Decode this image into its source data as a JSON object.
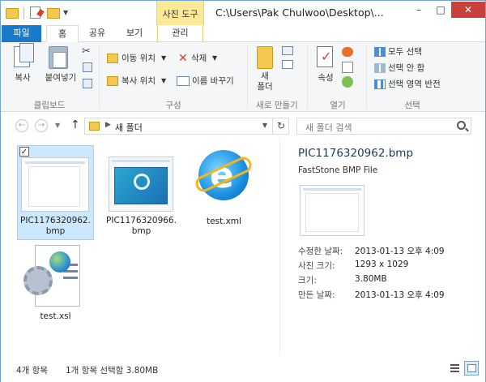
{
  "titlebar": {
    "context_tab": "사진 도구",
    "path": "C:\\Users\\Pak Chulwoo\\Desktop\\..."
  },
  "tabs": {
    "file": "파일",
    "home": "홈",
    "share": "공유",
    "view": "보기",
    "manage": "관리"
  },
  "ribbon": {
    "clipboard": {
      "label": "클립보드",
      "copy": "복사",
      "paste": "붙여넣기"
    },
    "organize": {
      "label": "구성",
      "move_to": "이동 위치",
      "copy_to": "복사 위치",
      "delete": "삭제",
      "rename": "이름 바꾸기"
    },
    "new": {
      "label": "새로 만들기",
      "new_folder": "새\n폴더"
    },
    "open": {
      "label": "열기",
      "properties": "속성"
    },
    "select": {
      "label": "선택",
      "select_all": "모두 선택",
      "select_none": "선택 안 함",
      "invert": "선택 영역 반전"
    }
  },
  "navigation": {
    "address": "새 폴더",
    "search_placeholder": "새 폴더 검색"
  },
  "files": [
    {
      "name": "PIC1176320962.\nbmp",
      "selected": true
    },
    {
      "name": "PIC1176320966.\nbmp",
      "selected": false
    },
    {
      "name": "test.xml",
      "selected": false
    },
    {
      "name": "test.xsl",
      "selected": false
    }
  ],
  "preview": {
    "title": "PIC1176320962.bmp",
    "type": "FastStone BMP File",
    "props": [
      {
        "label": "수정한 날짜:",
        "value": "2013-01-13 오후 4:09"
      },
      {
        "label": "사진 크기:",
        "value": "1293 x 1029"
      },
      {
        "label": "크기:",
        "value": "3.80MB"
      },
      {
        "label": "만든 날짜:",
        "value": "2013-01-13 오후 4:09"
      }
    ]
  },
  "status": {
    "count": "4개 항목",
    "selection": "1개 항목 선택함 3.80MB"
  }
}
